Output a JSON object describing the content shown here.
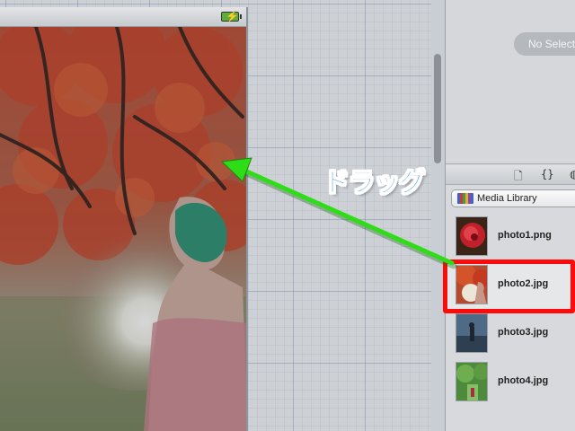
{
  "inspector": {
    "empty_label": "No Selection"
  },
  "library": {
    "selector_label": "Media Library",
    "toolbar_icons": [
      "file-icon",
      "braces-icon",
      "cube-icon"
    ],
    "items": [
      {
        "name": "photo1.png",
        "selected": false
      },
      {
        "name": "photo2.jpg",
        "selected": true
      },
      {
        "name": "photo3.jpg",
        "selected": false
      },
      {
        "name": "photo4.jpg",
        "selected": false
      }
    ]
  },
  "annotation": {
    "label": "ドラッグ",
    "label_color": "#0a78e0",
    "arrow_color": "#2fdc18",
    "highlight_color": "#ff0a0a"
  },
  "device": {
    "status_icon": "battery-charging-icon"
  }
}
